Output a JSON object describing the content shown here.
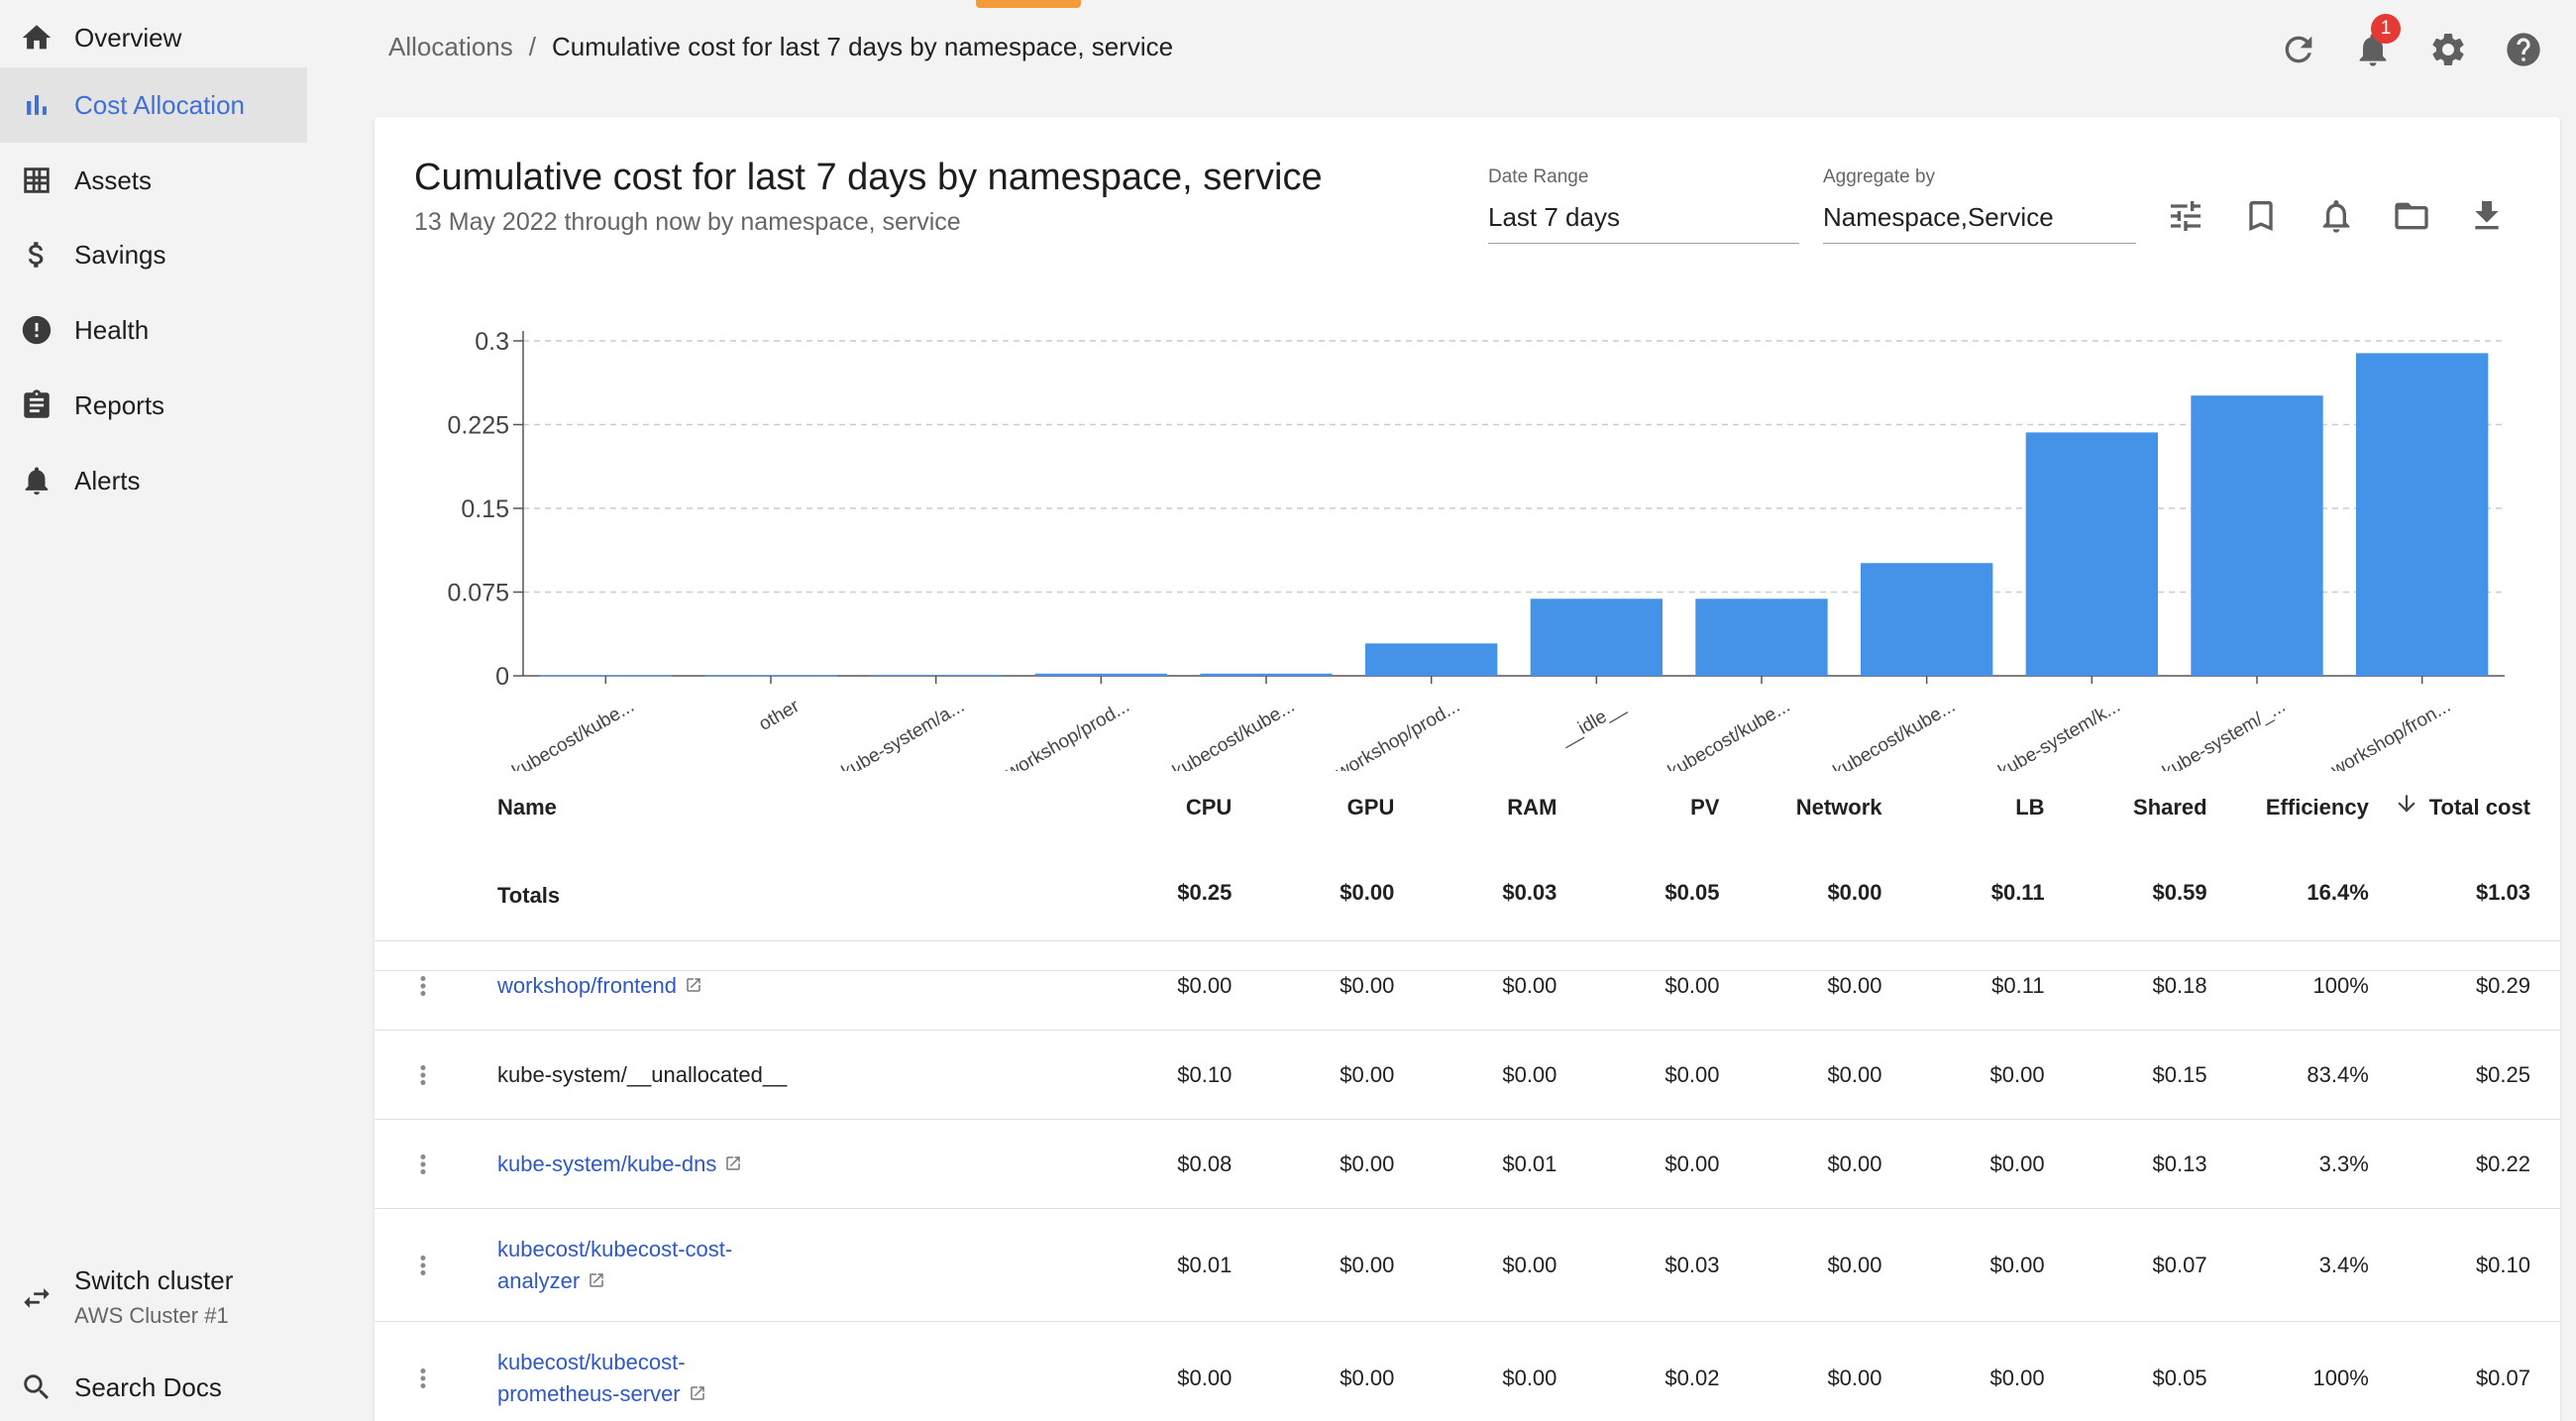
{
  "sidebar": {
    "items": [
      {
        "label": "Overview",
        "icon": "home-icon"
      },
      {
        "label": "Cost Allocation",
        "icon": "bar-chart-icon",
        "active": true
      },
      {
        "label": "Assets",
        "icon": "grid-icon"
      },
      {
        "label": "Savings",
        "icon": "dollar-icon"
      },
      {
        "label": "Health",
        "icon": "alert-circle-icon"
      },
      {
        "label": "Reports",
        "icon": "clipboard-icon"
      },
      {
        "label": "Alerts",
        "icon": "bell-icon"
      }
    ],
    "switch_cluster": {
      "title": "Switch cluster",
      "subtitle": "AWS Cluster #1",
      "icon": "swap-icon"
    },
    "search_docs": {
      "label": "Search Docs",
      "icon": "search-icon"
    }
  },
  "breadcrumb": {
    "parent": "Allocations",
    "separator": "/",
    "current": "Cumulative cost for last 7 days by namespace, service"
  },
  "topbar": {
    "notification_count": "1",
    "icons": [
      "refresh-icon",
      "bell-icon",
      "gear-icon",
      "help-icon"
    ]
  },
  "report": {
    "title": "Cumulative cost for last 7 days by namespace, service",
    "subtitle": "13 May 2022 through now by namespace, service",
    "date_range": {
      "label": "Date Range",
      "value": "Last 7 days"
    },
    "aggregate_by": {
      "label": "Aggregate by",
      "value": "Namespace,Service"
    },
    "action_icons": [
      "tune-icon",
      "bookmark-icon",
      "bell-icon",
      "folder-icon",
      "download-icon"
    ]
  },
  "chart_data": {
    "type": "bar",
    "categories": [
      "kubecost/kube...",
      "other",
      "kube-system/a...",
      "workshop/prod...",
      "kubecost/kube...",
      "workshop/prod...",
      "__idle__",
      "kubecost/kube...",
      "kubecost/kube...",
      "kube-system/k...",
      "kube-system/_...",
      "workshop/fron..."
    ],
    "values": [
      0.0005,
      0.0006,
      0.0008,
      0.002,
      0.002,
      0.029,
      0.069,
      0.069,
      0.101,
      0.218,
      0.251,
      0.289
    ],
    "yticks": [
      "0",
      "0.075",
      "0.15",
      "0.225",
      "0.3"
    ],
    "ylim": [
      0,
      0.3
    ],
    "grid": true,
    "color": "#4493e8"
  },
  "table": {
    "columns": [
      "Name",
      "CPU",
      "GPU",
      "RAM",
      "PV",
      "Network",
      "LB",
      "Shared",
      "Efficiency",
      "Total cost"
    ],
    "sort_icon": "arrow-down-icon",
    "totals": {
      "name": "Totals",
      "values": [
        "$0.25",
        "$0.00",
        "$0.03",
        "$0.05",
        "$0.00",
        "$0.11",
        "$0.59",
        "16.4%",
        "$1.03"
      ]
    },
    "rows": [
      {
        "name": [
          "workshop/frontend"
        ],
        "link": true,
        "values": [
          "$0.00",
          "$0.00",
          "$0.00",
          "$0.00",
          "$0.00",
          "$0.11",
          "$0.18",
          "100%",
          "$0.29"
        ]
      },
      {
        "name": [
          "kube-system/__unallocated__"
        ],
        "link": false,
        "values": [
          "$0.10",
          "$0.00",
          "$0.00",
          "$0.00",
          "$0.00",
          "$0.00",
          "$0.15",
          "83.4%",
          "$0.25"
        ]
      },
      {
        "name": [
          "kube-system/kube-dns"
        ],
        "link": true,
        "values": [
          "$0.08",
          "$0.00",
          "$0.01",
          "$0.00",
          "$0.00",
          "$0.00",
          "$0.13",
          "3.3%",
          "$0.22"
        ]
      },
      {
        "name": [
          "kubecost/kubecost-cost-",
          "analyzer"
        ],
        "link": true,
        "values": [
          "$0.01",
          "$0.00",
          "$0.00",
          "$0.03",
          "$0.00",
          "$0.00",
          "$0.07",
          "3.4%",
          "$0.10"
        ]
      },
      {
        "name": [
          "kubecost/kubecost-",
          "prometheus-server"
        ],
        "link": true,
        "values": [
          "$0.00",
          "$0.00",
          "$0.00",
          "$0.02",
          "$0.00",
          "$0.00",
          "$0.05",
          "100%",
          "$0.07"
        ]
      }
    ]
  }
}
